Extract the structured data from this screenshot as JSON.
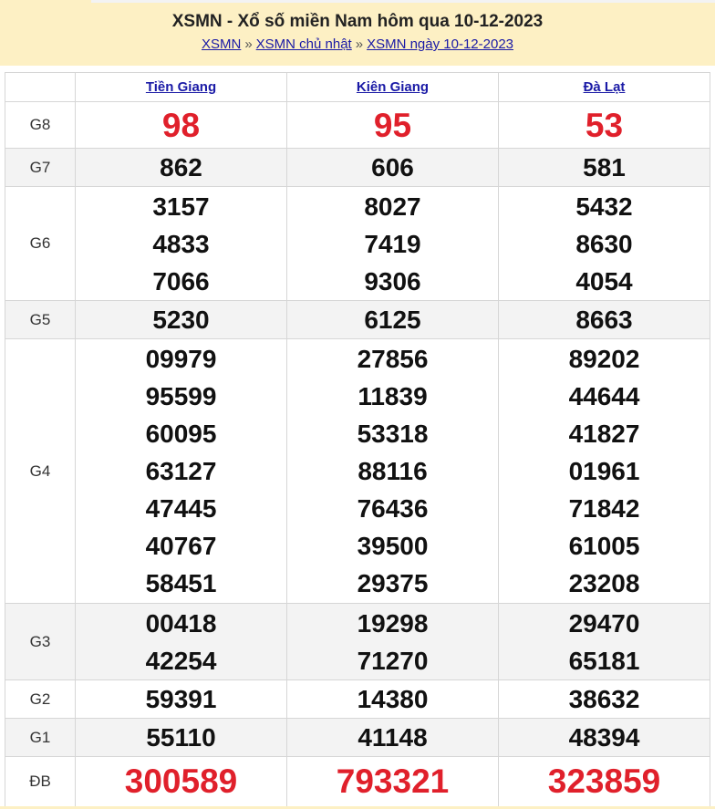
{
  "header": {
    "title": "XSMN - Xổ số miền Nam hôm qua 10-12-2023",
    "breadcrumb": [
      "XSMN",
      "XSMN chủ nhật",
      "XSMN ngày 10-12-2023"
    ],
    "separator": "»"
  },
  "provinces": [
    "Tiền Giang",
    "Kiên Giang",
    "Đà Lạt"
  ],
  "prizes": {
    "G8": {
      "label": "G8",
      "values": [
        [
          "98"
        ],
        [
          "95"
        ],
        [
          "53"
        ]
      ]
    },
    "G7": {
      "label": "G7",
      "values": [
        [
          "862"
        ],
        [
          "606"
        ],
        [
          "581"
        ]
      ]
    },
    "G6": {
      "label": "G6",
      "values": [
        [
          "3157",
          "4833",
          "7066"
        ],
        [
          "8027",
          "7419",
          "9306"
        ],
        [
          "5432",
          "8630",
          "4054"
        ]
      ]
    },
    "G5": {
      "label": "G5",
      "values": [
        [
          "5230"
        ],
        [
          "6125"
        ],
        [
          "8663"
        ]
      ]
    },
    "G4": {
      "label": "G4",
      "values": [
        [
          "09979",
          "95599",
          "60095",
          "63127",
          "47445",
          "40767",
          "58451"
        ],
        [
          "27856",
          "11839",
          "53318",
          "88116",
          "76436",
          "39500",
          "29375"
        ],
        [
          "89202",
          "44644",
          "41827",
          "01961",
          "71842",
          "61005",
          "23208"
        ]
      ]
    },
    "G3": {
      "label": "G3",
      "values": [
        [
          "00418",
          "42254"
        ],
        [
          "19298",
          "71270"
        ],
        [
          "29470",
          "65181"
        ]
      ]
    },
    "G2": {
      "label": "G2",
      "values": [
        [
          "59391"
        ],
        [
          "14380"
        ],
        [
          "38632"
        ]
      ]
    },
    "G1": {
      "label": "G1",
      "values": [
        [
          "55110"
        ],
        [
          "41148"
        ],
        [
          "48394"
        ]
      ]
    },
    "DB": {
      "label": "ĐB",
      "values": [
        [
          "300589"
        ],
        [
          "793321"
        ],
        [
          "323859"
        ]
      ]
    }
  },
  "colors": {
    "header_bg": "#fdf0c4",
    "special": "#e0202b",
    "link": "#1a1aa6",
    "alt_row": "#f3f3f3"
  }
}
